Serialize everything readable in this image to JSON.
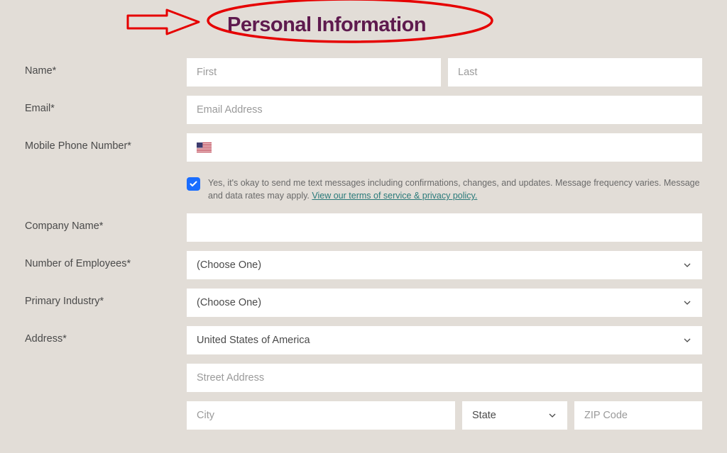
{
  "heading": "Personal Information",
  "labels": {
    "name": "Name*",
    "email": "Email*",
    "mobile": "Mobile Phone Number*",
    "company": "Company Name*",
    "employees": "Number of Employees*",
    "industry": "Primary Industry*",
    "address": "Address*"
  },
  "placeholders": {
    "first": "First",
    "last": "Last",
    "email": "Email Address",
    "street": "Street Address",
    "city": "City",
    "zip": "ZIP Code"
  },
  "selects": {
    "employees": "(Choose One)",
    "industry": "(Choose One)",
    "country": "United States of America",
    "state": "State"
  },
  "consent": {
    "text_before": "Yes, it's okay to send me text messages including confirmations, changes, and updates. Message frequency varies. Message and data rates may apply. ",
    "link": "View our terms of service & privacy policy."
  }
}
